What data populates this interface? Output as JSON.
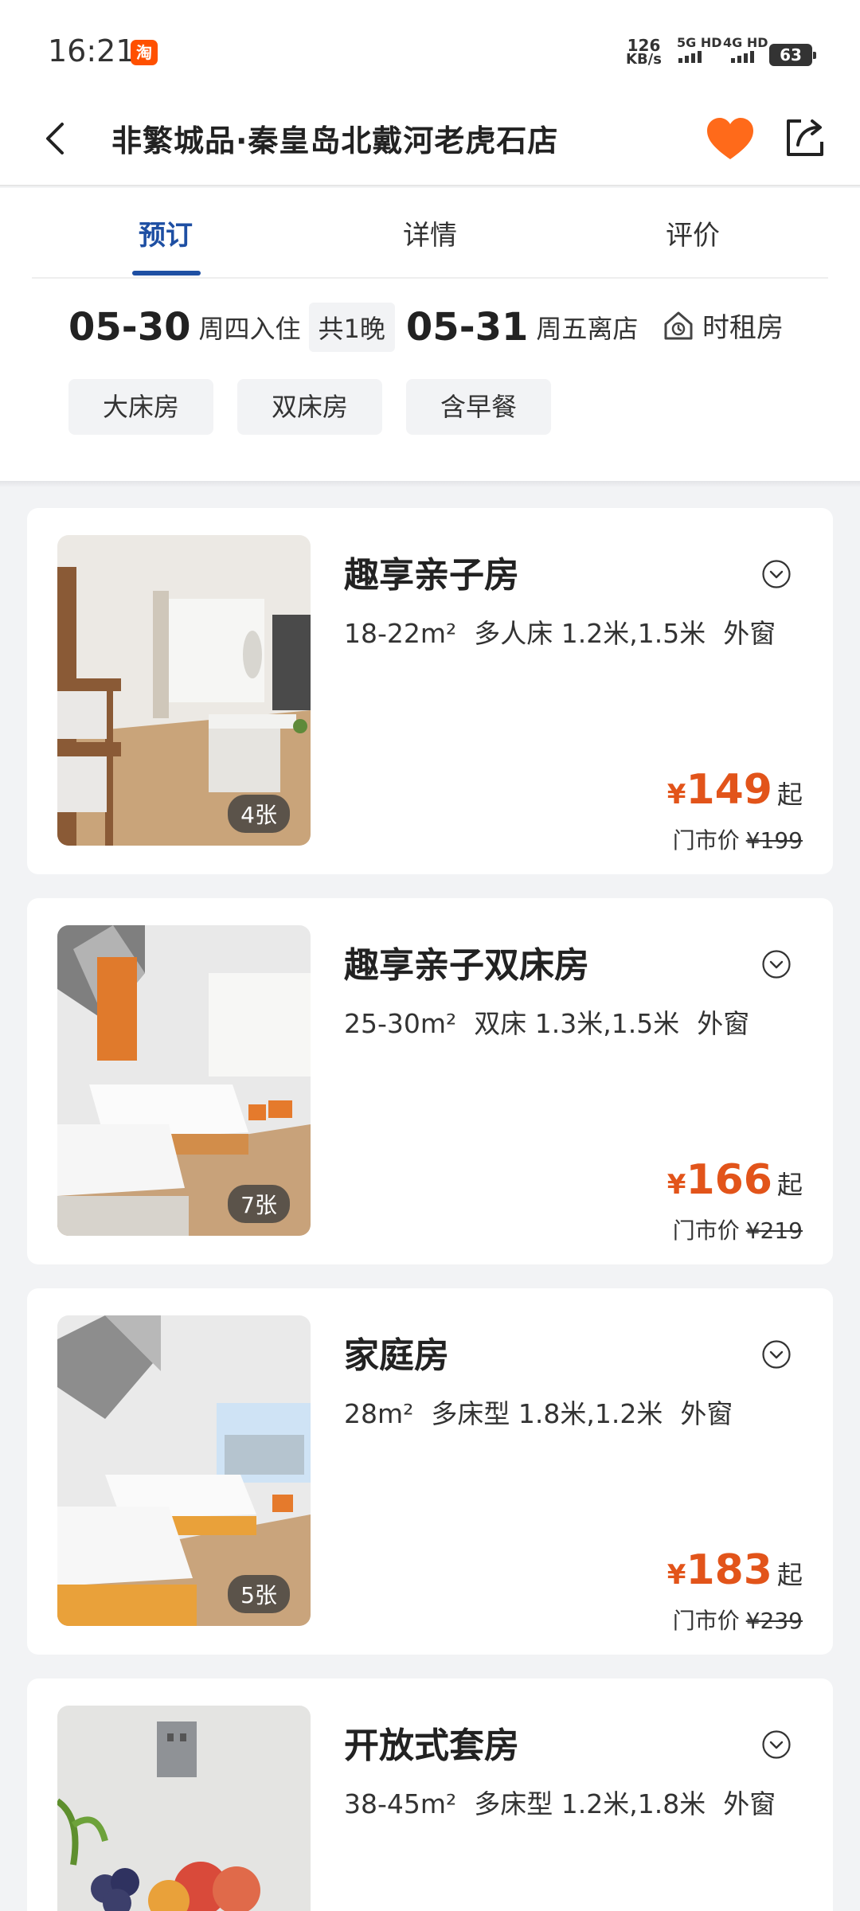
{
  "status_bar": {
    "time": "16:21",
    "taobao_icon_text": "淘",
    "net_speed": "126",
    "net_speed_unit": "KB/s",
    "sim1": "5G HD",
    "sim2": "4G HD",
    "battery": "63"
  },
  "header": {
    "title": "非繁城品·秦皇岛北戴河老虎石店"
  },
  "tabs": [
    {
      "label": "预订"
    },
    {
      "label": "详情"
    },
    {
      "label": "评价"
    }
  ],
  "dates": {
    "checkin_date": "05-30",
    "checkin_label": "周四入住",
    "nights": "共1晚",
    "checkout_date": "05-31",
    "checkout_label": "周五离店",
    "hourly_label": "时租房"
  },
  "filters": [
    {
      "label": "大床房"
    },
    {
      "label": "双床房"
    },
    {
      "label": "含早餐"
    }
  ],
  "rooms": [
    {
      "name": "趣享亲子房",
      "area": "18-22m²",
      "bed": "多人床 1.2米,1.5米",
      "window": "外窗",
      "photo_count": "4张",
      "currency": "¥",
      "price": "149",
      "price_suffix": "起",
      "market_label": "门市价",
      "market_price": "¥199"
    },
    {
      "name": "趣享亲子双床房",
      "area": "25-30m²",
      "bed": "双床 1.3米,1.5米",
      "window": "外窗",
      "photo_count": "7张",
      "currency": "¥",
      "price": "166",
      "price_suffix": "起",
      "market_label": "门市价",
      "market_price": "¥219"
    },
    {
      "name": "家庭房",
      "area": "28m²",
      "bed": "多床型 1.8米,1.2米",
      "window": "外窗",
      "photo_count": "5张",
      "currency": "¥",
      "price": "183",
      "price_suffix": "起",
      "market_label": "门市价",
      "market_price": "¥239"
    },
    {
      "name": "开放式套房",
      "area": "38-45m²",
      "bed": "多床型 1.2米,1.8米",
      "window": "外窗"
    }
  ],
  "colors": {
    "accent_blue": "#1e4fa3",
    "price_orange": "#e2541a",
    "favorite_orange": "#ff6a1a"
  },
  "icons": [
    "back-arrow-icon",
    "heart-icon",
    "share-icon",
    "hourly-room-icon",
    "chevron-down-circle-icon"
  ]
}
